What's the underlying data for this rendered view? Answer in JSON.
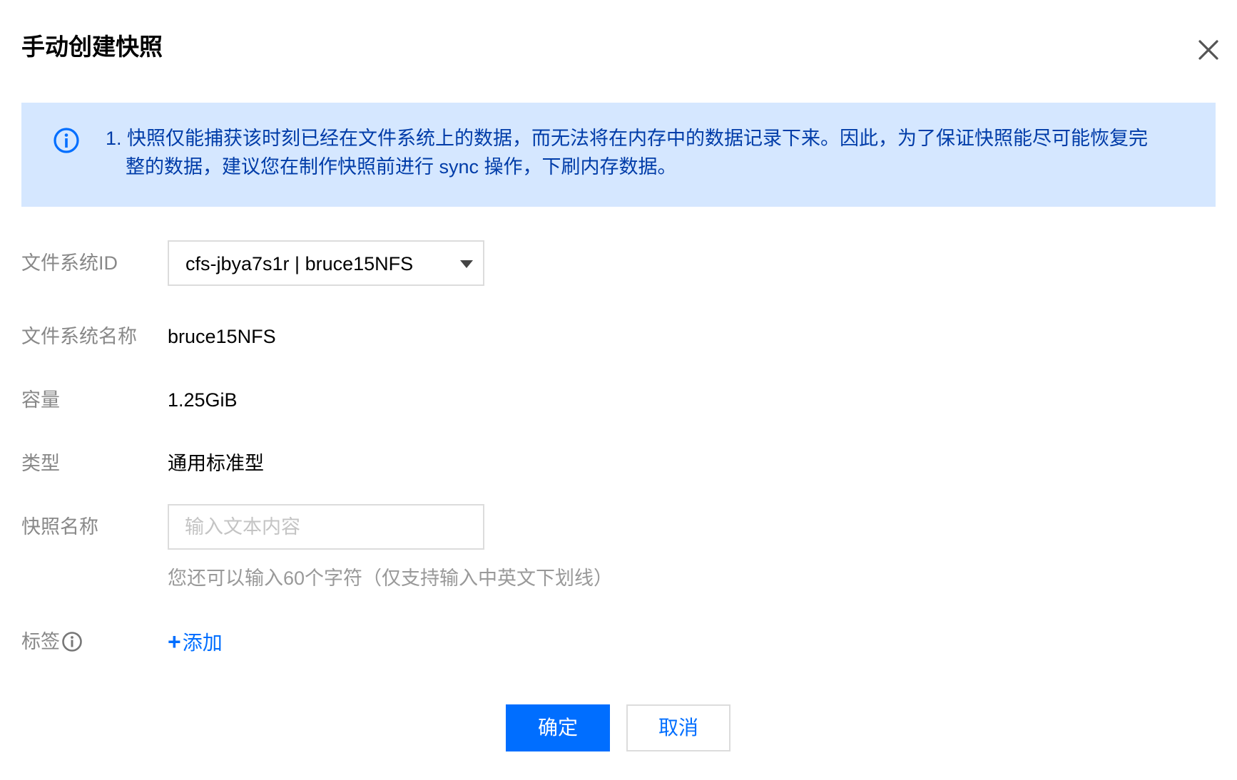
{
  "dialog": {
    "title": "手动创建快照",
    "close_icon": "close-icon"
  },
  "notice": {
    "icon": "info-circle-icon",
    "line1": "1. 快照仅能捕获该时刻已经在文件系统上的数据，而无法将在内存中的数据记录下来。因此，为了保证快照能尽可能恢复完",
    "line2": "整的数据，建议您在制作快照前进行 sync 操作，下刷内存数据。"
  },
  "form": {
    "fs_id": {
      "label": "文件系统ID",
      "selected": "cfs-jbya7s1r | bruce15NFS"
    },
    "fs_name": {
      "label": "文件系统名称",
      "value": "bruce15NFS"
    },
    "capacity": {
      "label": "容量",
      "value": "1.25GiB"
    },
    "type": {
      "label": "类型",
      "value": "通用标准型"
    },
    "snapshot_name": {
      "label": "快照名称",
      "placeholder": "输入文本内容",
      "value": "",
      "hint": "您还可以输入60个字符（仅支持输入中英文下划线）"
    },
    "tags": {
      "label": "标签",
      "add_label": "添加",
      "info_icon": "info-circle-icon"
    }
  },
  "footer": {
    "ok_label": "确定",
    "cancel_label": "取消"
  },
  "colors": {
    "primary": "#006eff",
    "notice_bg": "#d5e7ff",
    "notice_text": "#003ca8",
    "label": "#888888",
    "border": "#dcdcdc"
  }
}
